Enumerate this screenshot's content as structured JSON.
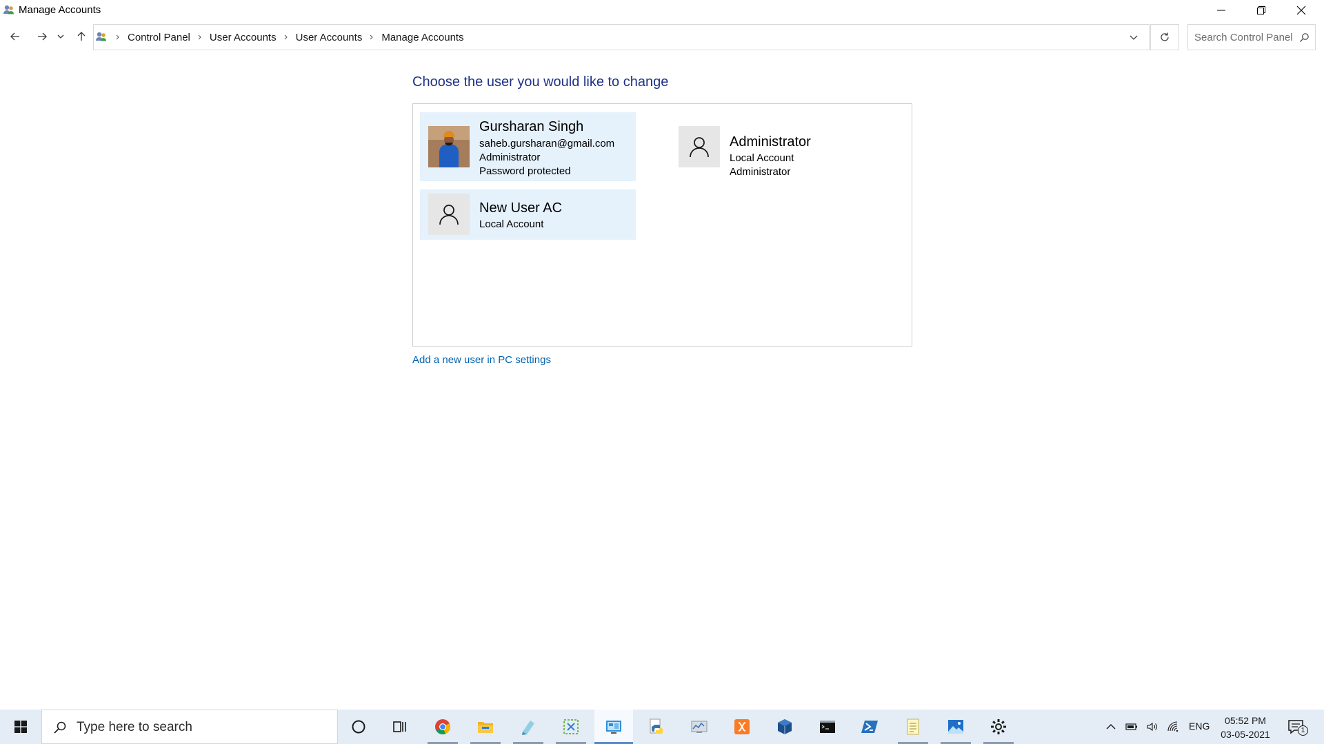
{
  "window": {
    "title": "Manage Accounts"
  },
  "address": {
    "breadcrumbs": [
      "Control Panel",
      "User Accounts",
      "User Accounts",
      "Manage Accounts"
    ],
    "search_placeholder": "Search Control Panel"
  },
  "content": {
    "heading": "Choose the user you would like to change",
    "users": [
      {
        "name": "Gursharan Singh",
        "lines": [
          "saheb.gursharan@gmail.com",
          "Administrator",
          "Password protected"
        ],
        "selected": true,
        "has_photo": true
      },
      {
        "name": "Administrator",
        "lines": [
          "Local Account",
          "Administrator"
        ],
        "selected": false,
        "has_photo": false
      },
      {
        "name": "New User AC",
        "lines": [
          "Local Account"
        ],
        "selected": true,
        "has_photo": false
      }
    ],
    "add_user_link": "Add a new user in PC settings"
  },
  "taskbar": {
    "search_placeholder": "Type here to search",
    "language": "ENG",
    "time": "05:52 PM",
    "date": "03-05-2021",
    "notification_count": "1",
    "apps": [
      "chrome-icon",
      "file-explorer-icon",
      "notepad-plus-icon",
      "snipping-tool-icon",
      "control-panel-icon",
      "python-icon",
      "resource-monitor-icon",
      "xampp-icon",
      "virtualbox-icon",
      "command-prompt-icon",
      "powershell-icon",
      "notepad-icon",
      "photos-icon",
      "settings-icon"
    ]
  },
  "colors": {
    "heading": "#1e3287",
    "link": "#0063b1",
    "selected_card": "#e5f1fb",
    "taskbar": "#e4ecf5"
  }
}
